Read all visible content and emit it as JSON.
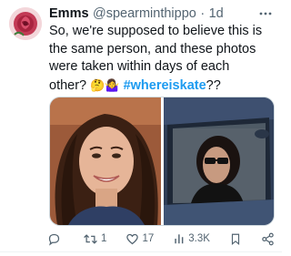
{
  "tweet": {
    "display_name": "Emms",
    "handle": "@spearminthippo",
    "separator": "·",
    "time": "1d",
    "text_lines": [
      "So, we're supposed to believe this is",
      "the same person, and these photos",
      "were taken within days of each"
    ],
    "last_line_text": "other?",
    "emojis": "🤔🤷‍♀️",
    "hashtag": "#whereiskate",
    "trailing": "??"
  },
  "actions": {
    "reply_count": "",
    "retweet_count": "1",
    "like_count": "17",
    "views_count": "3.3K"
  },
  "icons": {
    "avatar": "rose-avatar",
    "more": "more-dots-icon",
    "reply": "reply-icon",
    "retweet": "retweet-icon",
    "like": "heart-icon",
    "views": "views-chart-icon",
    "bookmark": "bookmark-icon",
    "share": "share-icon"
  },
  "colors": {
    "accent": "#1d9bf0",
    "secondary_text": "#536471",
    "text": "#0f1419"
  }
}
